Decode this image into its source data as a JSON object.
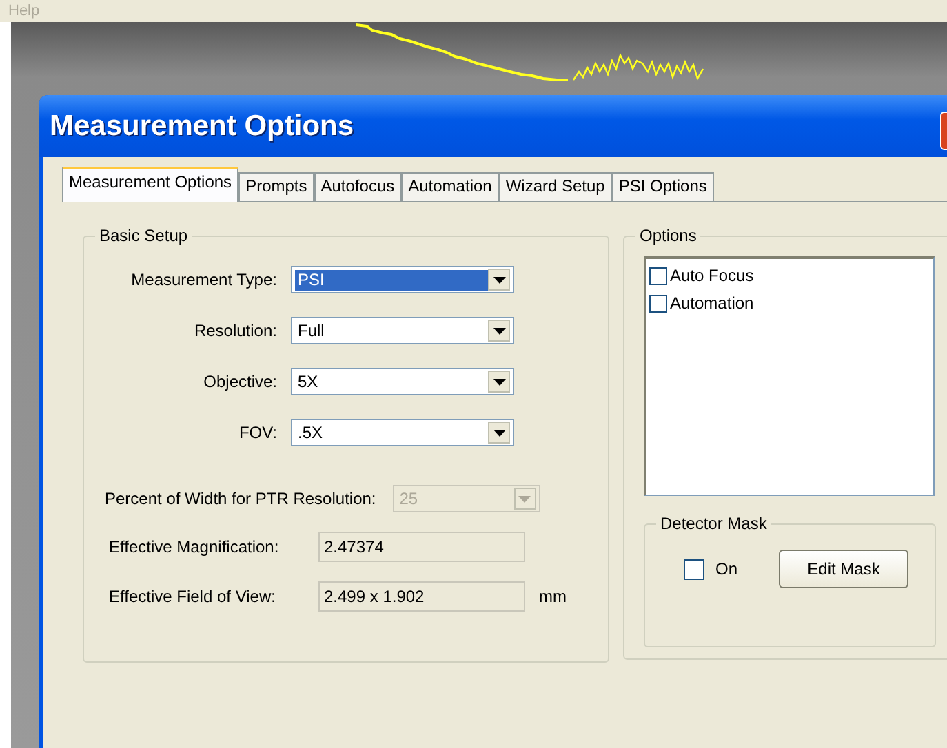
{
  "menu_bar": {
    "items": [
      {
        "label": "Help",
        "disabled": true
      }
    ]
  },
  "dialog": {
    "title": "Measurement Options",
    "tabs": [
      {
        "label": "Measurement Options",
        "selected": true
      },
      {
        "label": "Prompts",
        "selected": false
      },
      {
        "label": "Autofocus",
        "selected": false
      },
      {
        "label": "Automation",
        "selected": false
      },
      {
        "label": "Wizard Setup",
        "selected": false
      },
      {
        "label": "PSI Options",
        "selected": false
      }
    ],
    "basic_setup": {
      "title": "Basic Setup",
      "dropdowns": [
        {
          "label": "Measurement Type:",
          "value": "PSI",
          "highlighted": true
        },
        {
          "label": "Resolution:",
          "value": "Full",
          "highlighted": false
        },
        {
          "label": "Objective:",
          "value": "5X",
          "highlighted": false
        },
        {
          "label": "FOV:",
          "value": ".5X",
          "highlighted": false
        }
      ],
      "ptr_resolution": {
        "label": "Percent of Width for PTR Resolution:",
        "value": "25",
        "disabled": true
      },
      "readouts": [
        {
          "label": "Effective Magnification:",
          "value": "2.47374"
        },
        {
          "label": "Effective Field of View:",
          "value": "2.499 x 1.902",
          "unit": "mm"
        }
      ]
    },
    "options": {
      "title": "Options",
      "items": [
        {
          "label": "Auto Focus",
          "checked": false
        },
        {
          "label": "Automation",
          "checked": false
        }
      ],
      "detector_mask": {
        "title": "Detector Mask",
        "checkbox": {
          "label": "On",
          "checked": false
        },
        "button": "Edit Mask"
      }
    }
  }
}
